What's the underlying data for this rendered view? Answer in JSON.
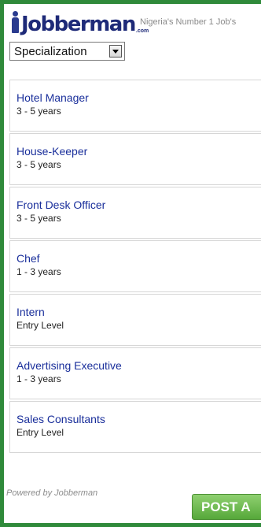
{
  "header": {
    "logo_text": "Jobberman",
    "logo_suffix": ".com",
    "tagline": "Nigeria's Number 1 Job's"
  },
  "filter": {
    "selected": "Specialization"
  },
  "jobs": [
    {
      "title": "Hotel Manager",
      "experience": "3 - 5 years"
    },
    {
      "title": "House-Keeper",
      "experience": "3 - 5 years"
    },
    {
      "title": "Front Desk Officer",
      "experience": "3 - 5 years"
    },
    {
      "title": "Chef",
      "experience": "1 - 3 years"
    },
    {
      "title": "Intern",
      "experience": "Entry Level"
    },
    {
      "title": "Advertising Executive",
      "experience": "1 - 3 years"
    },
    {
      "title": "Sales Consultants",
      "experience": "Entry Level"
    }
  ],
  "footer": {
    "powered_by": "Powered by Jobberman",
    "post_button": "POST A"
  },
  "colors": {
    "border_green": "#2f8a3a",
    "link_blue": "#1a2f9b",
    "button_green": "#56a83a"
  },
  "icons": {
    "logo_figure": "person-figure-icon",
    "dropdown": "chevron-down-icon"
  }
}
